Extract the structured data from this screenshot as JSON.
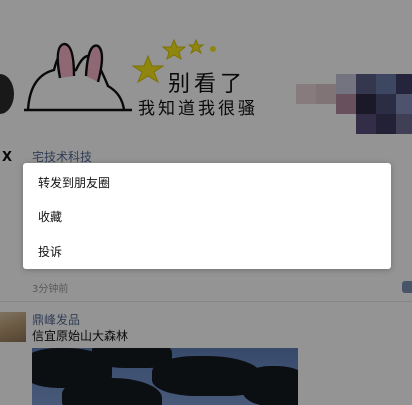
{
  "meme": {
    "line1": "别看了",
    "line2": "我知道我很骚"
  },
  "post1": {
    "author": "宅技术科技",
    "avatar_mark": "X",
    "time": "3分钟前"
  },
  "post2": {
    "author": "鼎峰发品",
    "text": "信宜原始山大森林"
  },
  "menu": {
    "items": [
      {
        "label": "转发到朋友圈"
      },
      {
        "label": "收藏"
      },
      {
        "label": "投诉"
      }
    ]
  },
  "colors": {
    "link_name": "#576b95",
    "overlay": "rgba(0,0,0,0.42)",
    "menu_bg": "#ffffff"
  }
}
